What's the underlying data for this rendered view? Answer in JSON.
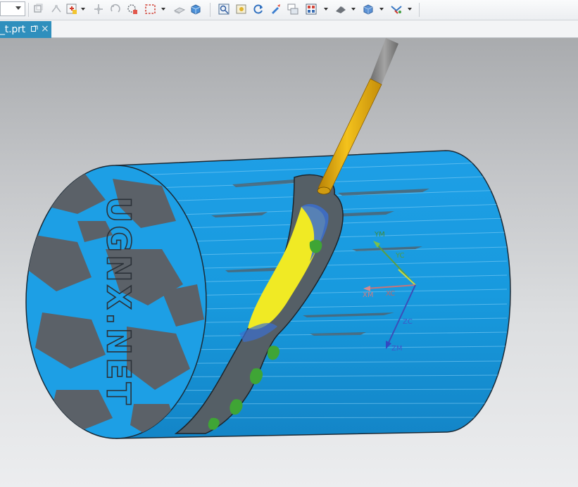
{
  "toolbar": {
    "buttons": [
      {
        "name": "orient-icon"
      },
      {
        "name": "snap-icon"
      },
      {
        "name": "add-component-icon"
      },
      {
        "name": "move-icon"
      },
      {
        "name": "rotate-icon"
      },
      {
        "name": "select-icon"
      },
      {
        "name": "marquee-icon"
      },
      {
        "name": "shaded-view-icon"
      },
      {
        "name": "solid-box-icon"
      },
      {
        "name": "fit-view-icon"
      },
      {
        "name": "zoom-icon"
      },
      {
        "name": "refresh-icon"
      },
      {
        "name": "paint-icon"
      },
      {
        "name": "layers-icon"
      },
      {
        "name": "grid-view-icon"
      },
      {
        "name": "render-style-icon"
      },
      {
        "name": "shade-cube-icon"
      },
      {
        "name": "filter-icon"
      }
    ]
  },
  "tab": {
    "label": "_t.prt",
    "close": "×"
  },
  "viewport": {
    "engraving_text": "UGNX.NET",
    "csys": {
      "ym": "YM",
      "yc": "YC",
      "xm": "XM",
      "xc": "XC",
      "zc": "ZC",
      "zm": "ZM"
    },
    "colors": {
      "stock_blue": "#1a9ee0",
      "cut_yellow": "#f0ea24",
      "gouge_green": "#3fa535",
      "tool_gold": "#e3a612"
    }
  }
}
